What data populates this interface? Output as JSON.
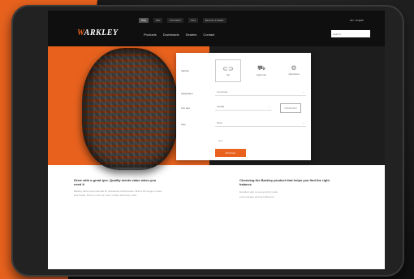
{
  "brand": {
    "name_prefix": "W",
    "name_rest": "ARKLEY",
    "accent": "#e8621e"
  },
  "header": {
    "utility": [
      "Why",
      "Site",
      "Innovation",
      "Find",
      "Become a dealer"
    ],
    "language": "EN · English",
    "nav": [
      "Products",
      "Downloads",
      "Dealers",
      "Contact"
    ],
    "search_placeholder": "Search..."
  },
  "selector": {
    "vehicle_label": "Vehicle",
    "vehicles": [
      {
        "icon": "car-icon",
        "label": "Car"
      },
      {
        "icon": "truck-icon",
        "label": "Light truck"
      },
      {
        "icon": "tractor-icon",
        "label": "Agricultural"
      }
    ],
    "fields": [
      {
        "label": "Application",
        "value": "Long haul"
      },
      {
        "label": "Tire size",
        "value": "315/80"
      },
      {
        "label": "Axle",
        "value": "Drive"
      }
    ],
    "size_hint": "315/80 R22",
    "extra": "Rim",
    "button": "Find tires"
  },
  "content": {
    "left_heading": "Drive with a great tyre. Quality meets value when you need it",
    "left_body": "Barkley offers tyres that last for thousands of kilometres. With a full range of sizes and treads, there is a tire for every vehicle and every road.",
    "right_heading": "Choosing the Barkley product that helps you find the right balance",
    "right_items": [
      "Excellent grip on wet and dry roads",
      "Long mileage and fuel efficiency"
    ]
  }
}
